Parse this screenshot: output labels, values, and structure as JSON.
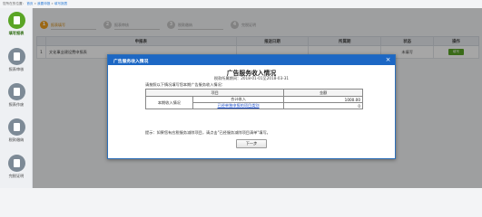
{
  "breadcrumb": {
    "prefix": "您所在的位置：",
    "items": [
      "首页",
      "我要申报",
      "填写报表"
    ]
  },
  "sidebar": {
    "items": [
      {
        "label": "填写报表",
        "icon": "form-icon",
        "active": true
      },
      {
        "label": "报表审核",
        "icon": "audit-icon",
        "active": false
      },
      {
        "label": "报表作废",
        "icon": "void-icon",
        "active": false
      },
      {
        "label": "税款缴纳",
        "icon": "payment-icon",
        "active": false
      },
      {
        "label": "完税证明",
        "icon": "certificate-icon",
        "active": false
      }
    ]
  },
  "steps": [
    {
      "num": "1",
      "label": "报表填写",
      "active": true
    },
    {
      "num": "2",
      "label": "报表审核",
      "active": false
    },
    {
      "num": "3",
      "label": "税款缴纳",
      "active": false
    },
    {
      "num": "4",
      "label": "完税证明",
      "active": false
    }
  ],
  "main_table": {
    "headers": [
      "申报表",
      "报送日期",
      "所属期",
      "状态",
      "操作"
    ],
    "rows": [
      {
        "num": "1",
        "name": "文化事业建设费申报表",
        "date": "",
        "period": "",
        "status": "未填写",
        "action": "填写"
      }
    ]
  },
  "dialog": {
    "title": "广告服务收入情况",
    "close_label": "×",
    "report_title": "广告服务收入情况",
    "period": "税款所属期间：2018-01-01至2018-03-31",
    "instruction": "请按照以下情况填写您本期广告服务收入情况：",
    "table": {
      "headers": [
        "项目",
        "金额"
      ],
      "row_label": "本期收入情况",
      "rows": [
        {
          "item": "合计收入",
          "amount": "1000.00"
        },
        {
          "item": "已经单独申报的项目类别",
          "amount": "0"
        }
      ]
    },
    "hint": "提示：如果您有应税服务减除项目，请点击\"已经服务减除项目清单\"填写。",
    "next_button": "下一步"
  }
}
